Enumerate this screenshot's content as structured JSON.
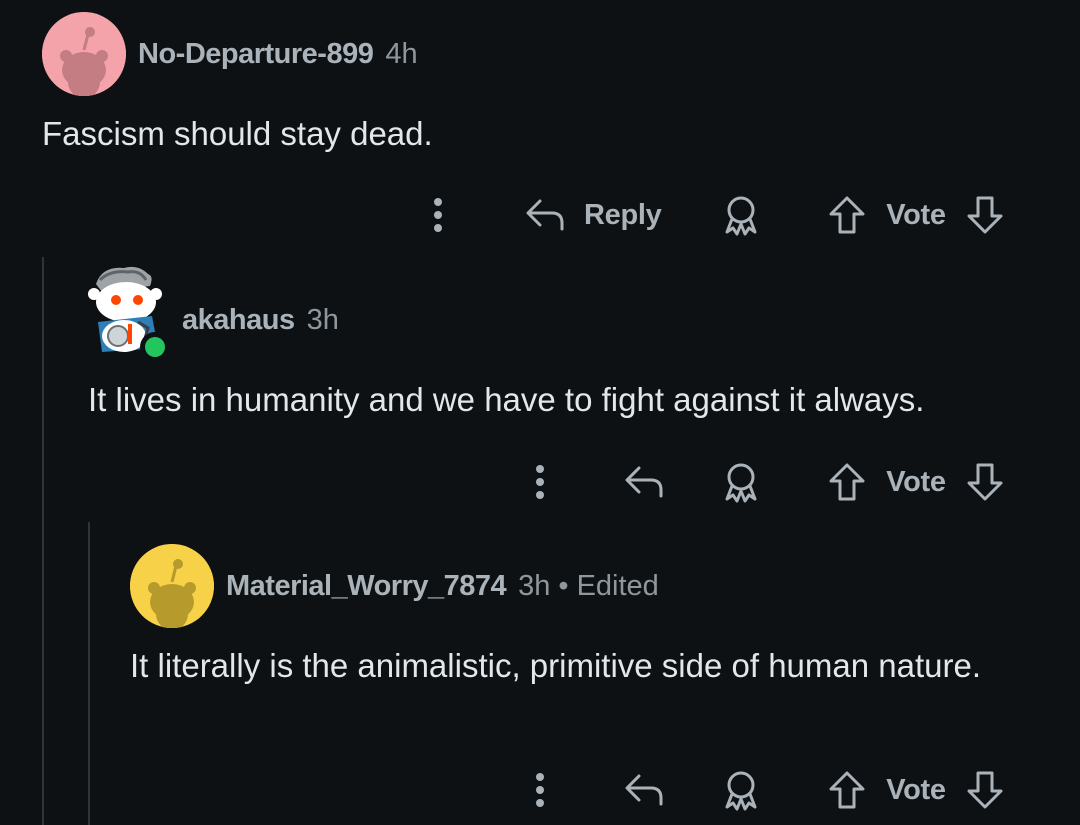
{
  "colors": {
    "background": "#0e1113",
    "thread_line": "#2f3438",
    "username": "#aab3ba",
    "body_text": "#e4e7e9",
    "online": "#22c55e"
  },
  "comments": [
    {
      "username": "No-Departure-899",
      "time": "4h",
      "body": "Fascism should stay dead.",
      "avatar_color": "#f4a3aa",
      "actions": {
        "reply_label": "Reply",
        "vote_label": "Vote"
      }
    },
    {
      "username": "akahaus",
      "time": "3h",
      "body": "It lives in humanity and we have to fight against it always.",
      "online": true,
      "actions": {
        "vote_label": "Vote"
      }
    },
    {
      "username": "Material_Worry_7874",
      "time": "3h",
      "separator": "•",
      "edited": "Edited",
      "body": "It literally is the animalistic, primitive side of human nature.",
      "avatar_color": "#f7d147",
      "actions": {
        "vote_label": "Vote"
      }
    }
  ],
  "icons": [
    "more-icon",
    "reply-icon",
    "award-icon",
    "upvote-icon",
    "downvote-icon"
  ]
}
